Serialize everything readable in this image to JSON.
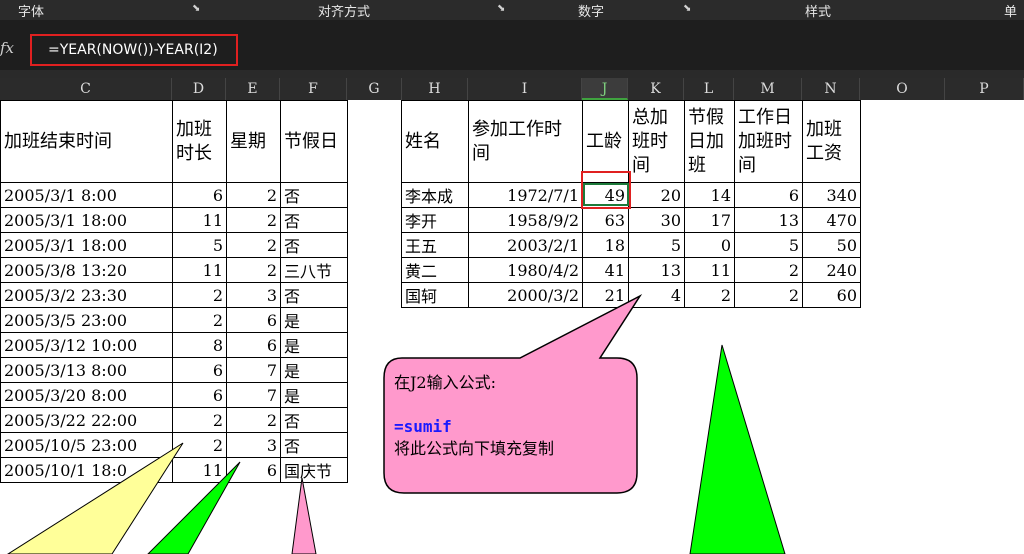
{
  "ribbon": {
    "groups": [
      {
        "label": "字体",
        "left": 0
      },
      {
        "label": "对齐方式"
      },
      {
        "label": "数字"
      },
      {
        "label": "样式"
      },
      {
        "label": "单"
      }
    ]
  },
  "formula_bar": {
    "fx_label": "fx",
    "formula": "=YEAR(NOW())-YEAR(I2)"
  },
  "columns": [
    "C",
    "D",
    "E",
    "F",
    "G",
    "H",
    "I",
    "J",
    "K",
    "L",
    "M",
    "N",
    "O",
    "P"
  ],
  "selected_column": "J",
  "left_table": {
    "headers": [
      "加班结束时间",
      "加班时长",
      "星期",
      "节假日"
    ],
    "rows": [
      [
        "2005/3/1 8:00",
        "6",
        "2",
        "否"
      ],
      [
        "2005/3/1 18:00",
        "11",
        "2",
        "否"
      ],
      [
        "2005/3/1 18:00",
        "5",
        "2",
        "否"
      ],
      [
        "2005/3/8 13:20",
        "11",
        "2",
        "三八节"
      ],
      [
        "2005/3/2 23:30",
        "2",
        "3",
        "否"
      ],
      [
        "2005/3/5 23:00",
        "2",
        "6",
        "是"
      ],
      [
        "2005/3/12 10:00",
        "8",
        "6",
        "是"
      ],
      [
        "2005/3/13 8:00",
        "6",
        "7",
        "是"
      ],
      [
        "2005/3/20 8:00",
        "6",
        "7",
        "是"
      ],
      [
        "2005/3/22 22:00",
        "2",
        "2",
        "否"
      ],
      [
        "2005/10/5 23:00",
        "2",
        "3",
        "否"
      ],
      [
        "2005/10/1 18:0",
        "11",
        "6",
        "国庆节"
      ]
    ]
  },
  "right_table": {
    "headers": [
      "姓名",
      "参加工作时间",
      "工龄",
      "总加班时间",
      "节假日加班",
      "工作日加班时间",
      "加班工资"
    ],
    "rows": [
      [
        "李本成",
        "1972/7/1",
        "49",
        "20",
        "14",
        "6",
        "340"
      ],
      [
        "李开",
        "1958/9/2",
        "63",
        "30",
        "17",
        "13",
        "470"
      ],
      [
        "王五",
        "2003/2/1",
        "18",
        "5",
        "0",
        "5",
        "50"
      ],
      [
        "黄二",
        "1980/4/2",
        "41",
        "13",
        "11",
        "2",
        "240"
      ],
      [
        "国轲",
        "2000/3/2",
        "21",
        "4",
        "2",
        "2",
        "60"
      ]
    ]
  },
  "callout": {
    "line1": "在J2输入公式:",
    "line2": "=sumif",
    "line3": "将此公式向下填充复制"
  },
  "colors": {
    "callout_fill": "#ff99cc",
    "yellow_shape": "#ffff99",
    "green_shape": "#00ff00",
    "pink_shape": "#ff99cc",
    "highlight_border": "#e02020",
    "active_cell_border": "#1d7a3a"
  }
}
